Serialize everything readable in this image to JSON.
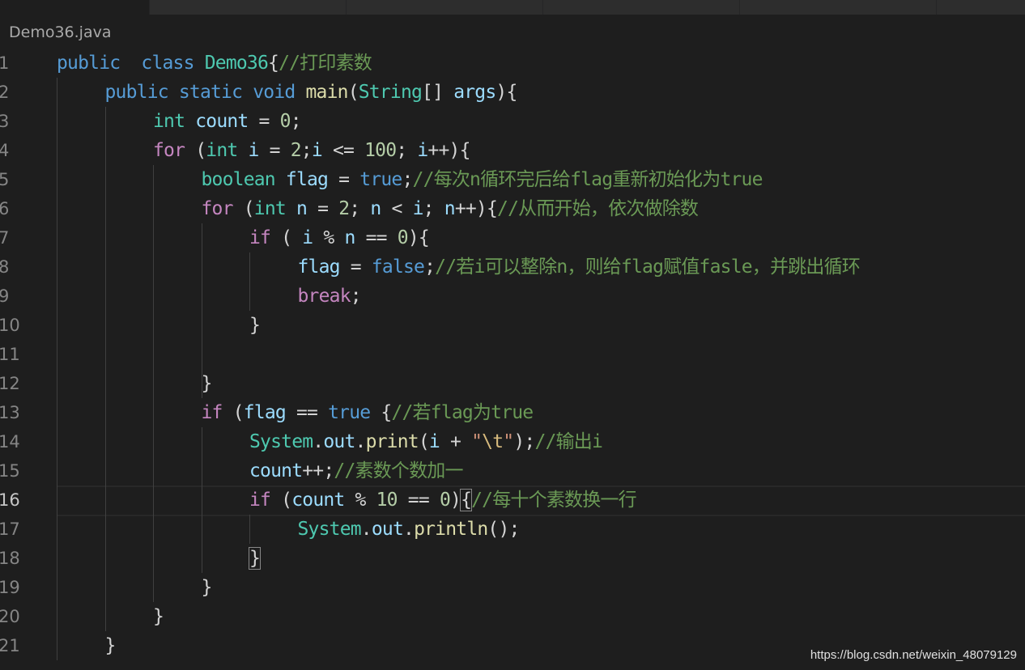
{
  "tabs": [
    {
      "label": "",
      "active": true
    },
    {
      "label": "",
      "active": false
    },
    {
      "label": "",
      "active": false
    },
    {
      "label": "",
      "active": false
    },
    {
      "label": "",
      "active": false
    },
    {
      "label": "",
      "active": false
    }
  ],
  "breadcrumb": "Demo36.java",
  "editor": {
    "current_line": 16,
    "line_numbers": [
      "1",
      "2",
      "3",
      "4",
      "5",
      "6",
      "7",
      "8",
      "9",
      "10",
      "11",
      "12",
      "13",
      "14",
      "15",
      "16",
      "17",
      "18",
      "19",
      "20",
      "21"
    ],
    "lines": [
      [
        [
          "kw",
          "public"
        ],
        [
          "",
          "  "
        ],
        [
          "kw",
          "class"
        ],
        [
          "",
          " "
        ],
        [
          "ty",
          "Demo36"
        ],
        [
          "",
          "{"
        ],
        [
          "cm",
          "//打印素数"
        ]
      ],
      [
        [
          "",
          ""
        ],
        [
          "kw",
          "public"
        ],
        [
          "",
          " "
        ],
        [
          "kw",
          "static"
        ],
        [
          "",
          " "
        ],
        [
          "kw",
          "void"
        ],
        [
          "",
          " "
        ],
        [
          "fn",
          "main"
        ],
        [
          "",
          "("
        ],
        [
          "ty",
          "String"
        ],
        [
          "",
          "[] "
        ],
        [
          "var",
          "args"
        ],
        [
          "",
          "){"
        ]
      ],
      [
        [
          "ty",
          "int"
        ],
        [
          "",
          " "
        ],
        [
          "var",
          "count"
        ],
        [
          "",
          " = "
        ],
        [
          "num",
          "0"
        ],
        [
          "",
          ";"
        ]
      ],
      [
        [
          "ctl",
          "for"
        ],
        [
          "",
          " ("
        ],
        [
          "ty",
          "int"
        ],
        [
          "",
          " "
        ],
        [
          "var",
          "i"
        ],
        [
          "",
          " = "
        ],
        [
          "num",
          "2"
        ],
        [
          "",
          ";"
        ],
        [
          "var",
          "i"
        ],
        [
          "",
          " <= "
        ],
        [
          "num",
          "100"
        ],
        [
          "",
          "; "
        ],
        [
          "var",
          "i"
        ],
        [
          "",
          "++){"
        ]
      ],
      [
        [
          "ty",
          "boolean"
        ],
        [
          "",
          " "
        ],
        [
          "var",
          "flag"
        ],
        [
          "",
          " = "
        ],
        [
          "kw",
          "true"
        ],
        [
          "",
          ";"
        ],
        [
          "cm",
          "//每次n循环完后给flag重新初始化为true"
        ]
      ],
      [
        [
          "ctl",
          "for"
        ],
        [
          "",
          " ("
        ],
        [
          "ty",
          "int"
        ],
        [
          "",
          " "
        ],
        [
          "var",
          "n"
        ],
        [
          "",
          " = "
        ],
        [
          "num",
          "2"
        ],
        [
          "",
          "; "
        ],
        [
          "var",
          "n"
        ],
        [
          "",
          " < "
        ],
        [
          "var",
          "i"
        ],
        [
          "",
          "; "
        ],
        [
          "var",
          "n"
        ],
        [
          "",
          "++){"
        ],
        [
          "cm",
          "//从而开始，依次做除数"
        ]
      ],
      [
        [
          "ctl",
          "if"
        ],
        [
          "",
          " ( "
        ],
        [
          "var",
          "i"
        ],
        [
          "",
          " % "
        ],
        [
          "var",
          "n"
        ],
        [
          "",
          " == "
        ],
        [
          "num",
          "0"
        ],
        [
          "",
          "){"
        ]
      ],
      [
        [
          "var",
          "flag"
        ],
        [
          "",
          " = "
        ],
        [
          "kw",
          "false"
        ],
        [
          "",
          ";"
        ],
        [
          "cm",
          "//若i可以整除n，则给flag赋值fasle，并跳出循环"
        ]
      ],
      [
        [
          "ctl",
          "break"
        ],
        [
          "",
          ";"
        ]
      ],
      [
        [
          "",
          "}"
        ]
      ],
      [
        [
          "",
          ""
        ]
      ],
      [
        [
          "",
          "}"
        ]
      ],
      [
        [
          "ctl",
          "if"
        ],
        [
          "",
          " ("
        ],
        [
          "var",
          "flag"
        ],
        [
          "",
          " == "
        ],
        [
          "kw",
          "true"
        ],
        [
          "",
          " {"
        ],
        [
          "cm",
          "//若flag为true"
        ]
      ],
      [
        [
          "ty",
          "System"
        ],
        [
          "",
          "."
        ],
        [
          "var",
          "out"
        ],
        [
          "",
          "."
        ],
        [
          "fn",
          "print"
        ],
        [
          "",
          "("
        ],
        [
          "var",
          "i"
        ],
        [
          "",
          " + "
        ],
        [
          "str",
          "\""
        ],
        [
          "esc",
          "\\t"
        ],
        [
          "str",
          "\""
        ],
        [
          "",
          ");"
        ],
        [
          "cm",
          "//输出i"
        ]
      ],
      [
        [
          "var",
          "count"
        ],
        [
          "",
          "++;"
        ],
        [
          "cm",
          "//素数个数加一"
        ]
      ],
      [
        [
          "ctl",
          "if"
        ],
        [
          "",
          " ("
        ],
        [
          "var",
          "count"
        ],
        [
          "",
          " % "
        ],
        [
          "num",
          "10"
        ],
        [
          "",
          " == "
        ],
        [
          "num",
          "0"
        ],
        [
          "",
          ")"
        ],
        [
          "bm",
          "{"
        ],
        [
          "cm",
          "//每十个素数换一行"
        ]
      ],
      [
        [
          "ty",
          "System"
        ],
        [
          "",
          "."
        ],
        [
          "var",
          "out"
        ],
        [
          "",
          "."
        ],
        [
          "fn",
          "println"
        ],
        [
          "",
          "();"
        ]
      ],
      [
        [
          "bm",
          "}"
        ]
      ],
      [
        [
          "",
          "}"
        ]
      ],
      [
        [
          "",
          "}"
        ]
      ],
      [
        [
          "",
          "}"
        ]
      ]
    ]
  },
  "watermark": "https://blog.csdn.net/weixin_48079129"
}
